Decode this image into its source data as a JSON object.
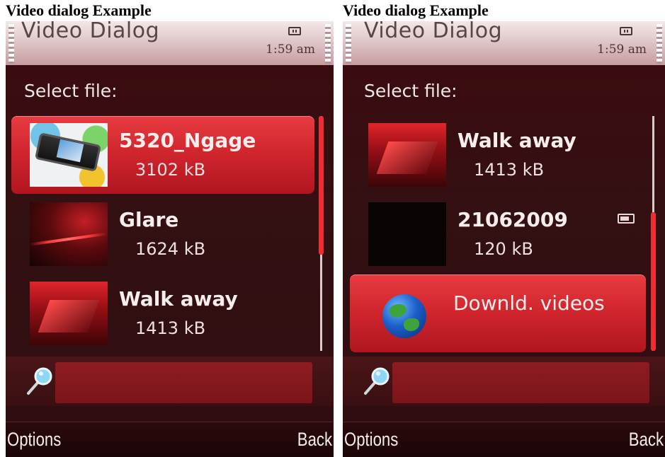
{
  "screens": [
    {
      "caption": "Video dialog Example",
      "app_title": "Video Dialog",
      "clock": "1:59 am",
      "prompt": "Select file:",
      "items": [
        {
          "name": "5320_Ngage",
          "size": "3102 kB",
          "thumbnail": "phone-thumbnail"
        },
        {
          "name": "Glare",
          "size": "1624 kB",
          "thumbnail": "glare-thumbnail"
        },
        {
          "name": "Walk away",
          "size": "1413 kB",
          "thumbnail": "walk-away-thumbnail"
        }
      ],
      "selected_item": "5320_Ngage",
      "softkeys": {
        "left": "Options",
        "right": "Back"
      }
    },
    {
      "caption": "Video dialog Example",
      "app_title": "Video Dialog",
      "clock": "1:59 am",
      "prompt": "Select file:",
      "items": [
        {
          "name": "Walk away",
          "size": "1413 kB",
          "thumbnail": "walk-away-thumbnail"
        },
        {
          "name": "21062009",
          "size": "120 kB",
          "thumbnail": "black-thumbnail",
          "badge": "memory-card-icon"
        },
        {
          "name": "Downld. videos",
          "thumbnail": "globe-icon"
        }
      ],
      "selected_item": "Downld. videos",
      "softkeys": {
        "left": "Options",
        "right": "Back"
      }
    }
  ],
  "colors": {
    "selection": "#d2262e",
    "background": "#331012",
    "text": "#f6eded"
  }
}
